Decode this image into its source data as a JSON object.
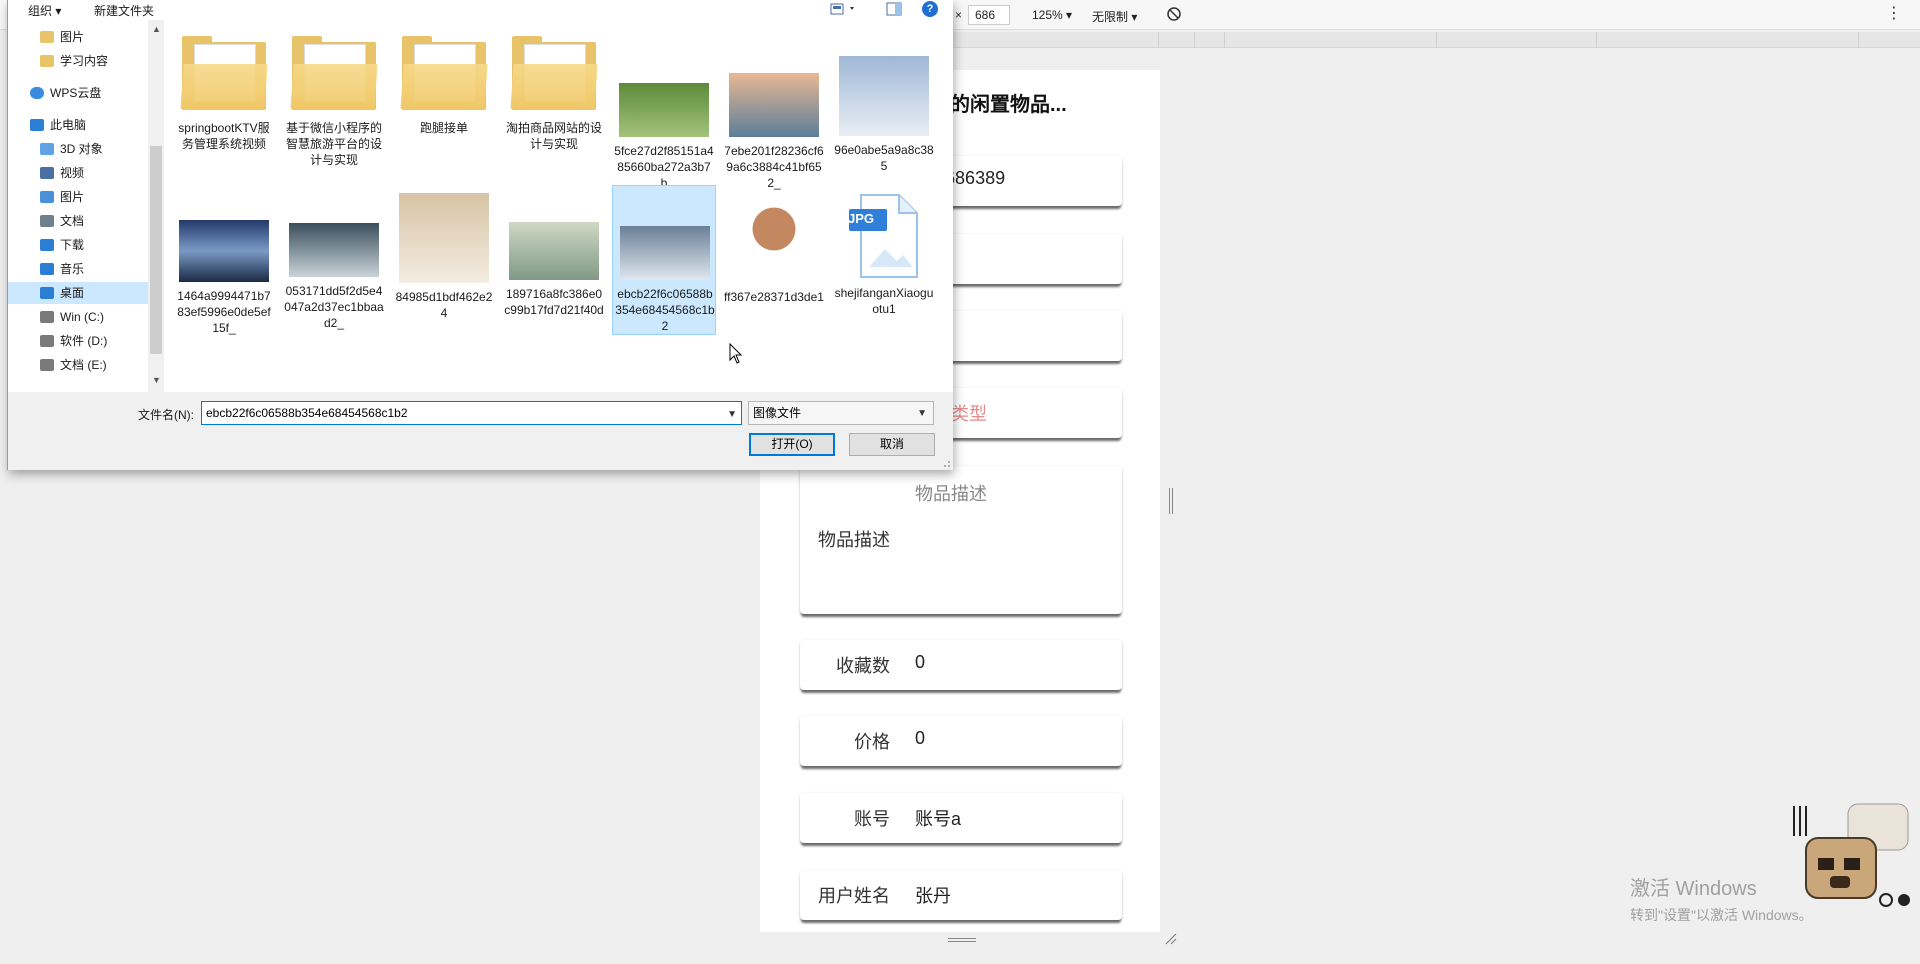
{
  "devtools": {
    "dim_separator": "×",
    "height_value": "686",
    "zoom": "125% ▾",
    "throttle": "无限制 ▾",
    "more": "⋮"
  },
  "page": {
    "title": "的闲置物品...",
    "fields": {
      "phone_partial": "335686389",
      "type_placeholder": "商品类型",
      "desc_hint": "物品描述",
      "desc_label": "物品描述",
      "fav_label": "收藏数",
      "fav_value": "0",
      "price_label": "价格",
      "price_value": "0",
      "account_label": "账号",
      "account_value": "账号a",
      "username_label": "用户姓名",
      "username_value": "张丹"
    }
  },
  "dialog": {
    "toolbar": {
      "organize": "组织 ▾",
      "new_folder": "新建文件夹",
      "help": "?"
    },
    "nav_items": [
      {
        "label": "图片",
        "icon": "folder-icon"
      },
      {
        "label": "学习内容",
        "icon": "folder-icon"
      },
      {
        "label": "WPS云盘",
        "icon": "cloud-icon"
      },
      {
        "label": "此电脑",
        "icon": "computer-icon"
      },
      {
        "label": "3D 对象",
        "icon": "cube-icon"
      },
      {
        "label": "视频",
        "icon": "video-icon"
      },
      {
        "label": "图片",
        "icon": "picture-icon"
      },
      {
        "label": "文档",
        "icon": "document-icon"
      },
      {
        "label": "下载",
        "icon": "download-icon"
      },
      {
        "label": "音乐",
        "icon": "music-icon"
      },
      {
        "label": "桌面",
        "icon": "desktop-icon"
      },
      {
        "label": "Win (C:)",
        "icon": "drive-icon"
      },
      {
        "label": "软件 (D:)",
        "icon": "drive-icon"
      },
      {
        "label": "文档 (E:)",
        "icon": "drive-icon"
      }
    ],
    "files": [
      {
        "name": "springbootKTV服务管理系统视频",
        "kind": "folder"
      },
      {
        "name": "基于微信小程序的智慧旅游平台的设计与实现",
        "kind": "folder"
      },
      {
        "name": "跑腿接单",
        "kind": "folder"
      },
      {
        "name": "淘拍商品网站的设计与实现",
        "kind": "folder"
      },
      {
        "name": "5fce27d2f85151a485660ba272a3b7b",
        "kind": "image"
      },
      {
        "name": "7ebe201f28236cf69a6c3884c41bf652_",
        "kind": "image"
      },
      {
        "name": "96e0abe5a9a8c385",
        "kind": "image"
      },
      {
        "name": "1464a9994471b783ef5996e0de5ef15f_",
        "kind": "image"
      },
      {
        "name": "053171dd5f2d5e4047a2d37ec1bbaad2_",
        "kind": "image"
      },
      {
        "name": "84985d1bdf462e24",
        "kind": "image"
      },
      {
        "name": "189716a8fc386e0c99b17fd7d21f40d",
        "kind": "image"
      },
      {
        "name": "ebcb22f6c06588b354e68454568c1b2",
        "kind": "image",
        "selected": true
      },
      {
        "name": "ff367e28371d3de1",
        "kind": "image"
      },
      {
        "name": "shejifanganXiaoguotu1",
        "kind": "jpg-file",
        "badge": "JPG"
      }
    ],
    "filename_label": "文件名(N):",
    "filename_value": "ebcb22f6c06588b354e68454568c1b2",
    "filetype_value": "图像文件",
    "open_button": "打开(O)",
    "cancel_button": "取消"
  },
  "watermark": {
    "line1": "激活 Windows",
    "line2": "转到\"设置\"以激活 Windows。"
  }
}
